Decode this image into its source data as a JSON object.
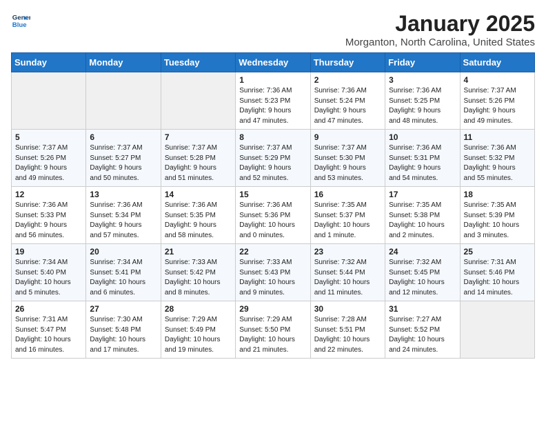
{
  "header": {
    "logo_line1": "General",
    "logo_line2": "Blue",
    "month_title": "January 2025",
    "location": "Morganton, North Carolina, United States"
  },
  "weekdays": [
    "Sunday",
    "Monday",
    "Tuesday",
    "Wednesday",
    "Thursday",
    "Friday",
    "Saturday"
  ],
  "weeks": [
    [
      {
        "day": "",
        "info": ""
      },
      {
        "day": "",
        "info": ""
      },
      {
        "day": "",
        "info": ""
      },
      {
        "day": "1",
        "info": "Sunrise: 7:36 AM\nSunset: 5:23 PM\nDaylight: 9 hours\nand 47 minutes."
      },
      {
        "day": "2",
        "info": "Sunrise: 7:36 AM\nSunset: 5:24 PM\nDaylight: 9 hours\nand 47 minutes."
      },
      {
        "day": "3",
        "info": "Sunrise: 7:36 AM\nSunset: 5:25 PM\nDaylight: 9 hours\nand 48 minutes."
      },
      {
        "day": "4",
        "info": "Sunrise: 7:37 AM\nSunset: 5:26 PM\nDaylight: 9 hours\nand 49 minutes."
      }
    ],
    [
      {
        "day": "5",
        "info": "Sunrise: 7:37 AM\nSunset: 5:26 PM\nDaylight: 9 hours\nand 49 minutes."
      },
      {
        "day": "6",
        "info": "Sunrise: 7:37 AM\nSunset: 5:27 PM\nDaylight: 9 hours\nand 50 minutes."
      },
      {
        "day": "7",
        "info": "Sunrise: 7:37 AM\nSunset: 5:28 PM\nDaylight: 9 hours\nand 51 minutes."
      },
      {
        "day": "8",
        "info": "Sunrise: 7:37 AM\nSunset: 5:29 PM\nDaylight: 9 hours\nand 52 minutes."
      },
      {
        "day": "9",
        "info": "Sunrise: 7:37 AM\nSunset: 5:30 PM\nDaylight: 9 hours\nand 53 minutes."
      },
      {
        "day": "10",
        "info": "Sunrise: 7:36 AM\nSunset: 5:31 PM\nDaylight: 9 hours\nand 54 minutes."
      },
      {
        "day": "11",
        "info": "Sunrise: 7:36 AM\nSunset: 5:32 PM\nDaylight: 9 hours\nand 55 minutes."
      }
    ],
    [
      {
        "day": "12",
        "info": "Sunrise: 7:36 AM\nSunset: 5:33 PM\nDaylight: 9 hours\nand 56 minutes."
      },
      {
        "day": "13",
        "info": "Sunrise: 7:36 AM\nSunset: 5:34 PM\nDaylight: 9 hours\nand 57 minutes."
      },
      {
        "day": "14",
        "info": "Sunrise: 7:36 AM\nSunset: 5:35 PM\nDaylight: 9 hours\nand 58 minutes."
      },
      {
        "day": "15",
        "info": "Sunrise: 7:36 AM\nSunset: 5:36 PM\nDaylight: 10 hours\nand 0 minutes."
      },
      {
        "day": "16",
        "info": "Sunrise: 7:35 AM\nSunset: 5:37 PM\nDaylight: 10 hours\nand 1 minute."
      },
      {
        "day": "17",
        "info": "Sunrise: 7:35 AM\nSunset: 5:38 PM\nDaylight: 10 hours\nand 2 minutes."
      },
      {
        "day": "18",
        "info": "Sunrise: 7:35 AM\nSunset: 5:39 PM\nDaylight: 10 hours\nand 3 minutes."
      }
    ],
    [
      {
        "day": "19",
        "info": "Sunrise: 7:34 AM\nSunset: 5:40 PM\nDaylight: 10 hours\nand 5 minutes."
      },
      {
        "day": "20",
        "info": "Sunrise: 7:34 AM\nSunset: 5:41 PM\nDaylight: 10 hours\nand 6 minutes."
      },
      {
        "day": "21",
        "info": "Sunrise: 7:33 AM\nSunset: 5:42 PM\nDaylight: 10 hours\nand 8 minutes."
      },
      {
        "day": "22",
        "info": "Sunrise: 7:33 AM\nSunset: 5:43 PM\nDaylight: 10 hours\nand 9 minutes."
      },
      {
        "day": "23",
        "info": "Sunrise: 7:32 AM\nSunset: 5:44 PM\nDaylight: 10 hours\nand 11 minutes."
      },
      {
        "day": "24",
        "info": "Sunrise: 7:32 AM\nSunset: 5:45 PM\nDaylight: 10 hours\nand 12 minutes."
      },
      {
        "day": "25",
        "info": "Sunrise: 7:31 AM\nSunset: 5:46 PM\nDaylight: 10 hours\nand 14 minutes."
      }
    ],
    [
      {
        "day": "26",
        "info": "Sunrise: 7:31 AM\nSunset: 5:47 PM\nDaylight: 10 hours\nand 16 minutes."
      },
      {
        "day": "27",
        "info": "Sunrise: 7:30 AM\nSunset: 5:48 PM\nDaylight: 10 hours\nand 17 minutes."
      },
      {
        "day": "28",
        "info": "Sunrise: 7:29 AM\nSunset: 5:49 PM\nDaylight: 10 hours\nand 19 minutes."
      },
      {
        "day": "29",
        "info": "Sunrise: 7:29 AM\nSunset: 5:50 PM\nDaylight: 10 hours\nand 21 minutes."
      },
      {
        "day": "30",
        "info": "Sunrise: 7:28 AM\nSunset: 5:51 PM\nDaylight: 10 hours\nand 22 minutes."
      },
      {
        "day": "31",
        "info": "Sunrise: 7:27 AM\nSunset: 5:52 PM\nDaylight: 10 hours\nand 24 minutes."
      },
      {
        "day": "",
        "info": ""
      }
    ]
  ]
}
